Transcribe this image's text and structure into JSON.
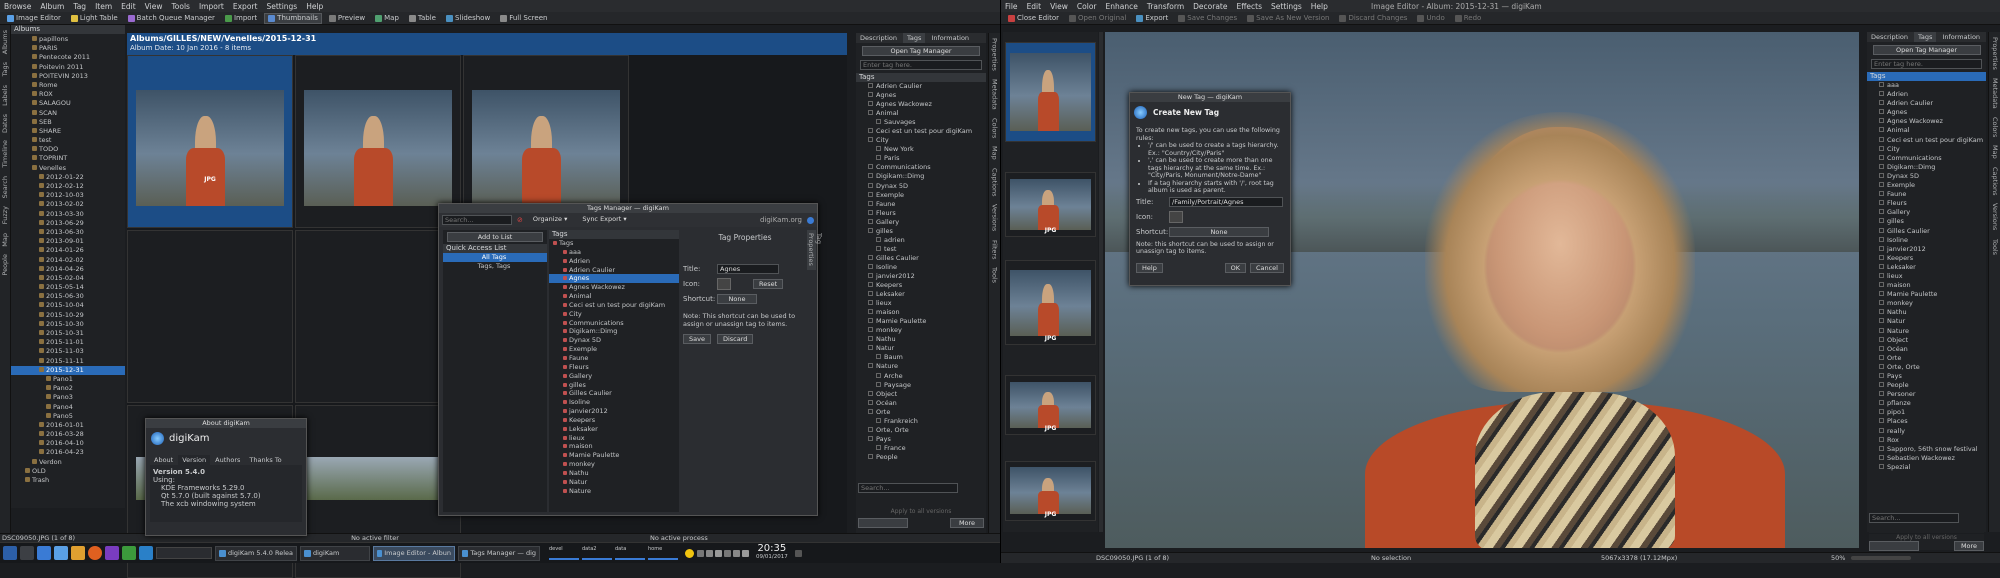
{
  "left": {
    "menu": [
      "Browse",
      "Album",
      "Tag",
      "Item",
      "Edit",
      "View",
      "Tools",
      "Import",
      "Export",
      "Settings",
      "Help"
    ],
    "toolbar": [
      {
        "label": "Image Editor",
        "on": false
      },
      {
        "label": "Light Table",
        "on": false
      },
      {
        "label": "Batch Queue Manager",
        "on": false
      },
      {
        "label": "Import",
        "on": false
      },
      {
        "label": "Thumbnails",
        "on": true
      },
      {
        "label": "Preview",
        "on": false
      },
      {
        "label": "Map",
        "on": false
      },
      {
        "label": "Table",
        "on": false
      },
      {
        "label": "Slideshow",
        "on": false
      },
      {
        "label": "Full Screen",
        "on": false
      }
    ],
    "left_vtabs": [
      "Albums",
      "Tags",
      "Labels",
      "Dates",
      "Timeline",
      "Search",
      "Fuzzy",
      "Map",
      "People"
    ],
    "albums_title": "Albums",
    "albums": [
      {
        "t": "papillons",
        "d": 3
      },
      {
        "t": "PARIS",
        "d": 3
      },
      {
        "t": "Pentecote 2011",
        "d": 3
      },
      {
        "t": "Poitevin 2011",
        "d": 3
      },
      {
        "t": "POITEVIN 2013",
        "d": 3
      },
      {
        "t": "Rome",
        "d": 3
      },
      {
        "t": "ROX",
        "d": 3
      },
      {
        "t": "SALAGOU",
        "d": 3
      },
      {
        "t": "SCAN",
        "d": 3
      },
      {
        "t": "SEB",
        "d": 3
      },
      {
        "t": "SHARE",
        "d": 3
      },
      {
        "t": "test",
        "d": 3
      },
      {
        "t": "TODO",
        "d": 3
      },
      {
        "t": "TOPRINT",
        "d": 3
      },
      {
        "t": "Venelles",
        "d": 3
      },
      {
        "t": "2012-01-22",
        "d": 4
      },
      {
        "t": "2012-02-12",
        "d": 4
      },
      {
        "t": "2012-10-03",
        "d": 4
      },
      {
        "t": "2013-02-02",
        "d": 4
      },
      {
        "t": "2013-03-30",
        "d": 4
      },
      {
        "t": "2013-06-29",
        "d": 4
      },
      {
        "t": "2013-06-30",
        "d": 4
      },
      {
        "t": "2013-09-01",
        "d": 4
      },
      {
        "t": "2014-01-26",
        "d": 4
      },
      {
        "t": "2014-02-02",
        "d": 4
      },
      {
        "t": "2014-04-26",
        "d": 4
      },
      {
        "t": "2015-02-04",
        "d": 4
      },
      {
        "t": "2015-05-14",
        "d": 4
      },
      {
        "t": "2015-06-30",
        "d": 4
      },
      {
        "t": "2015-10-04",
        "d": 4
      },
      {
        "t": "2015-10-29",
        "d": 4
      },
      {
        "t": "2015-10-30",
        "d": 4
      },
      {
        "t": "2015-10-31",
        "d": 4
      },
      {
        "t": "2015-11-01",
        "d": 4
      },
      {
        "t": "2015-11-03",
        "d": 4
      },
      {
        "t": "2015-11-11",
        "d": 4
      },
      {
        "t": "2015-12-31",
        "d": 4,
        "sel": true
      },
      {
        "t": "Pano1",
        "d": 5
      },
      {
        "t": "Pano2",
        "d": 5
      },
      {
        "t": "Pano3",
        "d": 5
      },
      {
        "t": "Pano4",
        "d": 5
      },
      {
        "t": "Pano5",
        "d": 5
      },
      {
        "t": "2016-01-01",
        "d": 4
      },
      {
        "t": "2016-03-28",
        "d": 4
      },
      {
        "t": "2016-04-10",
        "d": 4
      },
      {
        "t": "2016-04-23",
        "d": 4
      },
      {
        "t": "Verdon",
        "d": 3
      },
      {
        "t": "OLD",
        "d": 2
      },
      {
        "t": "Trash",
        "d": 2
      }
    ],
    "album_path": "Albums/GILLES/NEW/Venelles/2015-12-31",
    "album_info": "Album Date: 10 Jan 2016 - 8 items",
    "right_tabs": [
      "Description",
      "Tags",
      "Information"
    ],
    "open_tag_manager": "Open Tag Manager",
    "tags_placeholder": "Enter tag here.",
    "tags_title": "Tags",
    "tags": [
      {
        "t": "Adrien Caulier",
        "d": 1
      },
      {
        "t": "Agnes",
        "d": 1
      },
      {
        "t": "Agnes Wackowez",
        "d": 1
      },
      {
        "t": "Animal",
        "d": 1
      },
      {
        "t": "Sauvages",
        "d": 2
      },
      {
        "t": "Ceci est un test pour digiKam",
        "d": 1
      },
      {
        "t": "City",
        "d": 1
      },
      {
        "t": "New York",
        "d": 2
      },
      {
        "t": "Paris",
        "d": 2
      },
      {
        "t": "Communications",
        "d": 1
      },
      {
        "t": "Digikam::Dimg",
        "d": 1
      },
      {
        "t": "Dynax 5D",
        "d": 1
      },
      {
        "t": "Exemple",
        "d": 1
      },
      {
        "t": "Faune",
        "d": 1
      },
      {
        "t": "Fleurs",
        "d": 1
      },
      {
        "t": "Gallery",
        "d": 1
      },
      {
        "t": "gilles",
        "d": 1
      },
      {
        "t": "adrien",
        "d": 2
      },
      {
        "t": "test",
        "d": 2
      },
      {
        "t": "Gilles Caulier",
        "d": 1
      },
      {
        "t": "Isoline",
        "d": 1
      },
      {
        "t": "janvier2012",
        "d": 1
      },
      {
        "t": "Keepers",
        "d": 1
      },
      {
        "t": "Leksaker",
        "d": 1
      },
      {
        "t": "lieux",
        "d": 1
      },
      {
        "t": "maison",
        "d": 1
      },
      {
        "t": "Mamie Paulette",
        "d": 1
      },
      {
        "t": "monkey",
        "d": 1
      },
      {
        "t": "Nathu",
        "d": 1
      },
      {
        "t": "Natur",
        "d": 1
      },
      {
        "t": "Baum",
        "d": 2
      },
      {
        "t": "Nature",
        "d": 1
      },
      {
        "t": "Arche",
        "d": 2
      },
      {
        "t": "Paysage",
        "d": 2
      },
      {
        "t": "Object",
        "d": 1
      },
      {
        "t": "Océan",
        "d": 1
      },
      {
        "t": "Orte",
        "d": 1
      },
      {
        "t": "Frankreich",
        "d": 2
      },
      {
        "t": "Orte, Orte",
        "d": 1
      },
      {
        "t": "Pays",
        "d": 1
      },
      {
        "t": "France",
        "d": 2
      },
      {
        "t": "People",
        "d": 1
      }
    ],
    "search_placeholder": "Search...",
    "apply_label": "Apply to all versions",
    "more_label": "More",
    "side_vtabs": [
      "Properties",
      "Metadata",
      "Colors",
      "Map",
      "Captions",
      "Versions",
      "Filters",
      "Tools"
    ],
    "status_left": "DSC09050.JPG (1 of 8)",
    "status_center": "No active filter",
    "status_right": "No active process",
    "thumbs": [
      "JPG",
      "",
      "",
      "",
      "",
      ""
    ],
    "tag_manager": {
      "title": "Tags Manager — digiKam",
      "search": "Search...",
      "organize": "Organize",
      "sync_export": "Sync Export",
      "brand": "digiKam.org",
      "add_to_list": "Add to List",
      "quick_access": "Quick Access List",
      "all_tags": "All Tags",
      "tags_tags": "Tags, Tags",
      "tags_header": "Tags",
      "tag_items": [
        "Tags",
        "aaa",
        "Adrien",
        "Adrien Caulier",
        "Agnes",
        "Agnes Wackowez",
        "Animal",
        "Ceci est un test pour digiKam",
        "City",
        "Communications",
        "Digikam::Dimg",
        "Dynax 5D",
        "Exemple",
        "Faune",
        "Fleurs",
        "Gallery",
        "gilles",
        "Gilles Caulier",
        "Isoline",
        "janvier2012",
        "Keepers",
        "Leksaker",
        "lieux",
        "maison",
        "Mamie Paulette",
        "monkey",
        "Nathu",
        "Natur",
        "Nature"
      ],
      "props_title": "Tag Properties",
      "title_label": "Title:",
      "title_value": "Agnes",
      "icon_label": "Icon:",
      "reset": "Reset",
      "shortcut_label": "Shortcut:",
      "shortcut_value": "None",
      "note": "Note: This shortcut can be used to assign or unassign tag to items.",
      "save": "Save",
      "discard": "Discard",
      "side_tab": "Tag Properties"
    },
    "about": {
      "title": "About digiKam",
      "app": "digiKam",
      "tabs": [
        "About",
        "Version",
        "Authors",
        "Thanks To"
      ],
      "version": "Version 5.4.0",
      "using": "Using:",
      "libs": [
        "KDE Frameworks 5.29.0",
        "Qt 5.7.0 (built against 5.7.0)",
        "The xcb windowing system"
      ]
    }
  },
  "right": {
    "title": "Image Editor - Album: 2015-12-31 — digiKam",
    "menu": [
      "File",
      "Edit",
      "View",
      "Color",
      "Enhance",
      "Transform",
      "Decorate",
      "Effects",
      "Settings",
      "Help"
    ],
    "toolbar": [
      "Close Editor",
      "Open Original",
      "Export",
      "Save Changes",
      "Save As New Version",
      "Discard Changes",
      "Undo",
      "Redo"
    ],
    "filmstrip": [
      "",
      "JPG",
      "JPG",
      "JPG",
      "JPG"
    ],
    "dialog": {
      "title": "New Tag — digiKam",
      "heading": "Create New Tag",
      "intro": "To create new tags, you can use the following rules:",
      "rules": [
        "'/' can be used to create a tags hierarchy. Ex.: \"Country/City/Paris\"",
        "',' can be used to create more than one tags hierarchy at the same time. Ex.: \"City/Paris, Monument/Notre-Dame\"",
        "If a tag hierarchy starts with '/', root tag album is used as parent."
      ],
      "title_label": "Title:",
      "title_value": "/Family/Portrait/Agnes",
      "icon_label": "Icon:",
      "shortcut_label": "Shortcut:",
      "shortcut_value": "None",
      "note": "Note: this shortcut can be used to assign or unassign tag to items.",
      "help": "Help",
      "ok": "OK",
      "cancel": "Cancel"
    },
    "right_tabs": [
      "Description",
      "Tags",
      "Information"
    ],
    "open_tag_manager": "Open Tag Manager",
    "tags_placeholder": "Enter tag here.",
    "tags_title": "Tags",
    "tags": [
      {
        "t": "aaa",
        "d": 1
      },
      {
        "t": "Adrien",
        "d": 1
      },
      {
        "t": "Adrien Caulier",
        "d": 1
      },
      {
        "t": "Agnes",
        "d": 1
      },
      {
        "t": "Agnes Wackowez",
        "d": 1
      },
      {
        "t": "Animal",
        "d": 1
      },
      {
        "t": "Ceci est un test pour digiKam",
        "d": 1
      },
      {
        "t": "City",
        "d": 1
      },
      {
        "t": "Communications",
        "d": 1
      },
      {
        "t": "Digikam::Dimg",
        "d": 1
      },
      {
        "t": "Dynax 5D",
        "d": 1
      },
      {
        "t": "Exemple",
        "d": 1
      },
      {
        "t": "Faune",
        "d": 1
      },
      {
        "t": "Fleurs",
        "d": 1
      },
      {
        "t": "Gallery",
        "d": 1
      },
      {
        "t": "gilles",
        "d": 1
      },
      {
        "t": "Gilles Caulier",
        "d": 1
      },
      {
        "t": "Isoline",
        "d": 1
      },
      {
        "t": "janvier2012",
        "d": 1
      },
      {
        "t": "Keepers",
        "d": 1
      },
      {
        "t": "Leksaker",
        "d": 1
      },
      {
        "t": "lieux",
        "d": 1
      },
      {
        "t": "maison",
        "d": 1
      },
      {
        "t": "Mamie Paulette",
        "d": 1
      },
      {
        "t": "monkey",
        "d": 1
      },
      {
        "t": "Nathu",
        "d": 1
      },
      {
        "t": "Natur",
        "d": 1
      },
      {
        "t": "Nature",
        "d": 1
      },
      {
        "t": "Object",
        "d": 1
      },
      {
        "t": "Océan",
        "d": 1
      },
      {
        "t": "Orte",
        "d": 1
      },
      {
        "t": "Orte, Orte",
        "d": 1
      },
      {
        "t": "Pays",
        "d": 1
      },
      {
        "t": "People",
        "d": 1
      },
      {
        "t": "Personer",
        "d": 1
      },
      {
        "t": "pflanze",
        "d": 1
      },
      {
        "t": "pipo1",
        "d": 1
      },
      {
        "t": "Places",
        "d": 1
      },
      {
        "t": "really",
        "d": 1
      },
      {
        "t": "Rox",
        "d": 1
      },
      {
        "t": "Sapporo, 56th snow festival",
        "d": 1
      },
      {
        "t": "Sebastien Wackowez",
        "d": 1
      },
      {
        "t": "Spezial",
        "d": 1
      }
    ],
    "side_vtabs": [
      "Properties",
      "Metadata",
      "Colors",
      "Map",
      "Captions",
      "Versions",
      "Tools"
    ],
    "search_placeholder": "Search...",
    "apply_label": "Apply to all versions",
    "more_label": "More",
    "status_left": "DSC09050.JPG (1 of 8)",
    "status_center": "No selection",
    "status_right": "5067x3378 (17.12Mpx)",
    "zoom": "50%"
  },
  "taskbar": {
    "tasks": [
      {
        "label": "digiKam 5.4.0 Relea",
        "on": false
      },
      {
        "label": "digiKam",
        "on": false
      },
      {
        "label": "Image Editor - Albun",
        "on": true
      },
      {
        "label": "Tags Manager — dig",
        "on": false
      }
    ],
    "meters": [
      "devel",
      "data2",
      "data",
      "home"
    ],
    "clock": "20:35",
    "date": "09/01/2017"
  }
}
